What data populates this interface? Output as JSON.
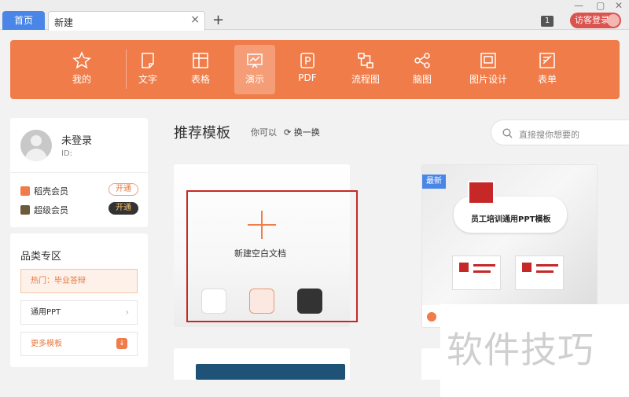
{
  "titlebar": {
    "home_tab": "首页",
    "new_tab": "新建",
    "badge": "1",
    "guest_login": "访客登录"
  },
  "toolbar": {
    "items": [
      {
        "label": "我的",
        "icon": "star-icon"
      },
      {
        "label": "文字",
        "icon": "document-icon"
      },
      {
        "label": "表格",
        "icon": "table-icon"
      },
      {
        "label": "演示",
        "icon": "presentation-icon"
      },
      {
        "label": "PDF",
        "icon": "pdf-icon"
      },
      {
        "label": "流程图",
        "icon": "flowchart-icon"
      },
      {
        "label": "脑图",
        "icon": "mindmap-icon"
      },
      {
        "label": "图片设计",
        "icon": "image-design-icon"
      },
      {
        "label": "表单",
        "icon": "form-icon"
      }
    ],
    "active": "演示"
  },
  "user": {
    "name": "未登录",
    "id_label": "ID:",
    "memberships": [
      {
        "label": "稻壳会员",
        "action": "开通"
      },
      {
        "label": "超级会员",
        "action": "开通"
      }
    ]
  },
  "categories": {
    "title": "品类专区",
    "hot": "热门：毕业答辩",
    "items": [
      "通用PPT",
      "更多模板"
    ]
  },
  "main": {
    "title": "推荐模板",
    "you_can": "你可以",
    "refresh": "换一换",
    "search_placeholder": "直接搜你想要的",
    "new_blank": "新建空白文档",
    "new_badge": "最新",
    "template_name": "员工培训通用PPT模板"
  },
  "watermark": "软件技巧",
  "colors": {
    "accent": "#f07c49",
    "tab_blue": "#4a86e8",
    "highlight_red": "#c62828"
  }
}
